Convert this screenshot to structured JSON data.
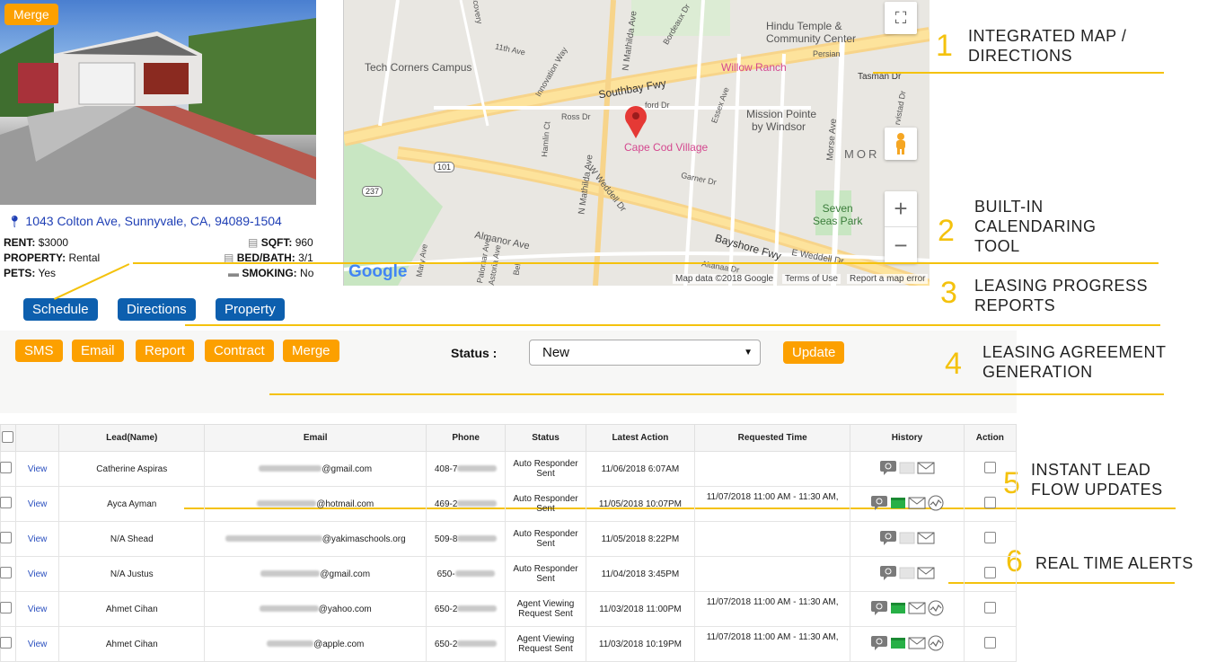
{
  "property": {
    "merge_label": "Merge",
    "address": "1043 Colton Ave, Sunnyvale, CA, 94089-1504",
    "rent_label": "RENT:",
    "rent_value": "$3000",
    "property_label": "PROPERTY:",
    "property_value": "Rental",
    "pets_label": "PETS:",
    "pets_value": "Yes",
    "sqft_label": "SQFT:",
    "sqft_value": "960",
    "bedbath_label": "BED/BATH:",
    "bedbath_value": "3/1",
    "smoking_label": "SMOKING:",
    "smoking_value": "No"
  },
  "property_buttons": {
    "schedule": "Schedule",
    "directions": "Directions",
    "property": "Property"
  },
  "map": {
    "labels": [
      "Hindu Temple &",
      "Community Center",
      "Tech Corners Campus",
      "Willow Ranch",
      "Southbay Fwy",
      "Mission Pointe",
      "by Windsor",
      "Cape Cod Village",
      "MOR",
      "Seven",
      "Seas Park",
      "Almanor Ave",
      "Bayshore Fwy",
      "E Weddell Dr",
      "W Weddell Dr",
      "N Mathilda Ave",
      "Tasman Dr",
      "Ross Dr",
      "Hamlin Ct",
      "Garner Dr",
      "Morse Ave",
      "Essex Ave",
      "Persian",
      "11th Ave",
      "Innovation Way",
      "Discovery",
      "Bordeaux Dr",
      "Mary Ave",
      "Palomar Ave",
      "Astoria Ave",
      "Bel",
      "Altanaa Dr",
      "ford Dr",
      "rvistad Dr",
      "101",
      "237"
    ],
    "google": "Google",
    "map_data": "Map data ©2018 Google",
    "terms": "Terms of Use",
    "report_error": "Report a map error",
    "zoom_in": "+",
    "zoom_out": "−"
  },
  "actions": {
    "sms": "SMS",
    "email": "Email",
    "report": "Report",
    "contract": "Contract",
    "merge": "Merge",
    "status_label": "Status :",
    "status_value": "New",
    "update": "Update"
  },
  "annotations": [
    {
      "num": "1",
      "line1": "INTEGRATED MAP /",
      "line2": "DIRECTIONS",
      "line3": ""
    },
    {
      "num": "2",
      "line1": "BUILT-IN",
      "line2": "CALENDARING",
      "line3": "TOOL"
    },
    {
      "num": "3",
      "line1": "LEASING PROGRESS",
      "line2": "REPORTS",
      "line3": ""
    },
    {
      "num": "4",
      "line1": "LEASING AGREEMENT",
      "line2": "GENERATION",
      "line3": ""
    },
    {
      "num": "5",
      "line1": "INSTANT LEAD",
      "line2": "FLOW UPDATES",
      "line3": ""
    },
    {
      "num": "6",
      "line1": "REAL TIME ALERTS",
      "line2": "",
      "line3": ""
    }
  ],
  "table": {
    "headers": [
      "",
      "",
      "Lead(Name)",
      "Email",
      "Phone",
      "Status",
      "Latest Action",
      "Requested Time",
      "History",
      "Action"
    ],
    "view_label": "View",
    "rows": [
      {
        "name": "Catherine Aspiras",
        "email_suffix": "@gmail.com",
        "phone_prefix": "408-7",
        "status1": "Auto Responder",
        "status2": "Sent",
        "latest": "11/06/2018 6:07AM",
        "requested": "",
        "green": false,
        "wave": false
      },
      {
        "name": "Ayca Ayman",
        "email_suffix": "@hotmail.com",
        "phone_prefix": "469-2",
        "status1": "Auto Responder",
        "status2": "Sent",
        "latest": "11/05/2018 10:07PM",
        "requested": "11/07/2018 11:00 AM - 11:30 AM,",
        "green": true,
        "wave": true
      },
      {
        "name": "N/A Shead",
        "email_suffix": "@yakimaschools.org",
        "phone_prefix": "509-8",
        "status1": "Auto Responder",
        "status2": "Sent",
        "latest": "11/05/2018 8:22PM",
        "requested": "",
        "green": false,
        "wave": false
      },
      {
        "name": "N/A Justus",
        "email_suffix": "@gmail.com",
        "phone_prefix": "650-",
        "status1": "Auto Responder",
        "status2": "Sent",
        "latest": "11/04/2018 3:45PM",
        "requested": "",
        "green": false,
        "wave": false
      },
      {
        "name": "Ahmet Cihan",
        "email_suffix": "@yahoo.com",
        "phone_prefix": "650-2",
        "status1": "Agent Viewing",
        "status2": "Request Sent",
        "latest": "11/03/2018 11:00PM",
        "requested": "11/07/2018 11:00 AM - 11:30 AM,",
        "green": true,
        "wave": true
      },
      {
        "name": "Ahmet Cihan",
        "email_suffix": "@apple.com",
        "phone_prefix": "650-2",
        "status1": "Agent Viewing",
        "status2": "Request Sent",
        "latest": "11/03/2018 10:19PM",
        "requested": "11/07/2018 11:00 AM - 11:30 AM,",
        "green": true,
        "wave": true
      }
    ]
  },
  "colors": {
    "accent_orange": "#fca000",
    "accent_blue": "#0d5fae",
    "annotation_yellow": "#f4c20d"
  }
}
